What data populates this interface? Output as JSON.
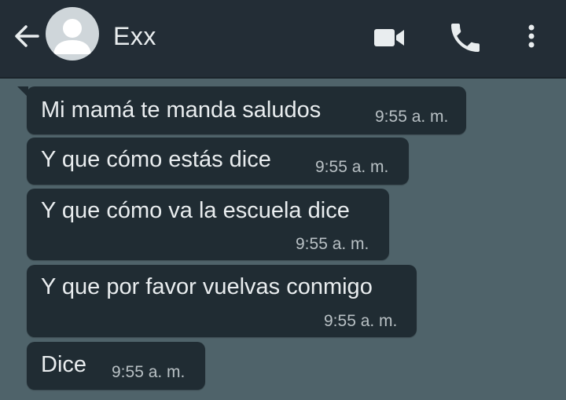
{
  "header": {
    "contact_name": "Exx",
    "back_icon": "arrow-left-icon",
    "avatar_icon": "default-person-avatar",
    "video_icon": "video-camera-icon",
    "call_icon": "phone-icon",
    "menu_icon": "more-vertical-icon"
  },
  "colors": {
    "header_bg": "#232d36",
    "chat_bg": "#4f636a",
    "bubble_bg": "#202c33",
    "text": "#e9edef",
    "time_text": "#b8c0c4"
  },
  "messages": [
    {
      "text": "Mi mamá te manda saludos",
      "time": "9:55 a. m."
    },
    {
      "text": "Y que cómo estás dice",
      "time": "9:55 a. m."
    },
    {
      "text": "Y que cómo va la escuela dice",
      "time": "9:55 a. m."
    },
    {
      "text": "Y que por favor vuelvas conmigo",
      "time": "9:55 a. m."
    },
    {
      "text": "Dice",
      "time": "9:55 a. m."
    }
  ]
}
